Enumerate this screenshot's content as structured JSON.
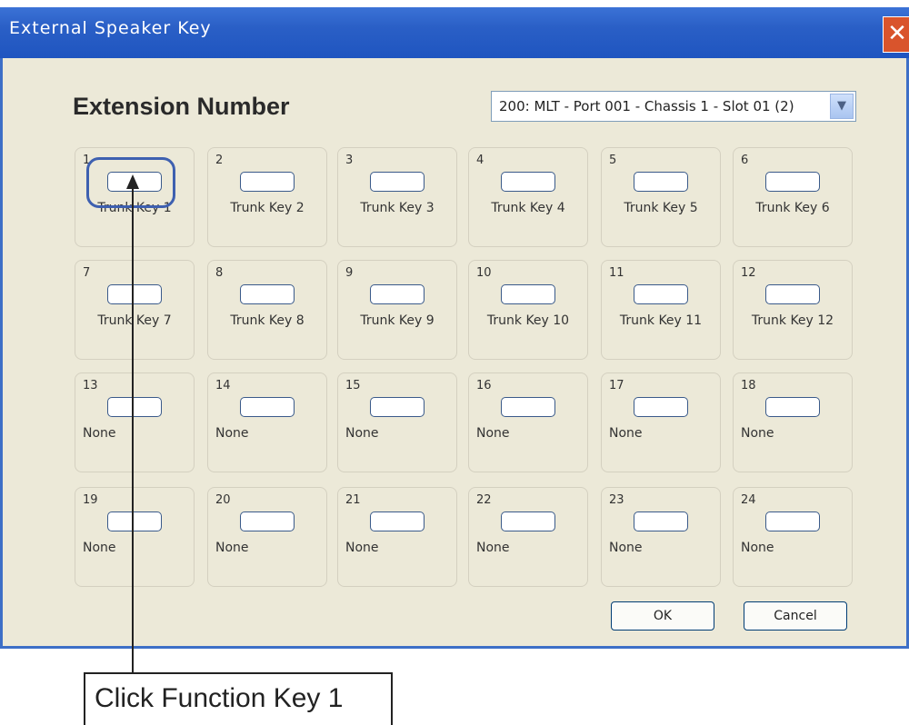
{
  "window": {
    "title": "External Speaker Key",
    "close_symbol": "✕"
  },
  "heading": "Extension Number",
  "extension_select": {
    "selected": "200: MLT - Port 001 - Chassis 1 - Slot 01 (2)",
    "arrow_symbol": "▼"
  },
  "keys": [
    {
      "num": "1",
      "label": "Trunk Key 1"
    },
    {
      "num": "2",
      "label": "Trunk Key 2"
    },
    {
      "num": "3",
      "label": "Trunk Key 3"
    },
    {
      "num": "4",
      "label": "Trunk Key 4"
    },
    {
      "num": "5",
      "label": "Trunk Key 5"
    },
    {
      "num": "6",
      "label": "Trunk Key 6"
    },
    {
      "num": "7",
      "label": "Trunk Key 7"
    },
    {
      "num": "8",
      "label": "Trunk Key 8"
    },
    {
      "num": "9",
      "label": "Trunk Key 9"
    },
    {
      "num": "10",
      "label": "Trunk Key 10"
    },
    {
      "num": "11",
      "label": "Trunk Key 11"
    },
    {
      "num": "12",
      "label": "Trunk Key 12"
    },
    {
      "num": "13",
      "label": "None"
    },
    {
      "num": "14",
      "label": "None"
    },
    {
      "num": "15",
      "label": "None"
    },
    {
      "num": "16",
      "label": "None"
    },
    {
      "num": "17",
      "label": "None"
    },
    {
      "num": "18",
      "label": "None"
    },
    {
      "num": "19",
      "label": "None"
    },
    {
      "num": "20",
      "label": "None"
    },
    {
      "num": "21",
      "label": "None"
    },
    {
      "num": "22",
      "label": "None"
    },
    {
      "num": "23",
      "label": "None"
    },
    {
      "num": "24",
      "label": "None"
    }
  ],
  "buttons": {
    "ok": "OK",
    "cancel": "Cancel"
  },
  "callout": {
    "text": "Click Function Key 1"
  }
}
